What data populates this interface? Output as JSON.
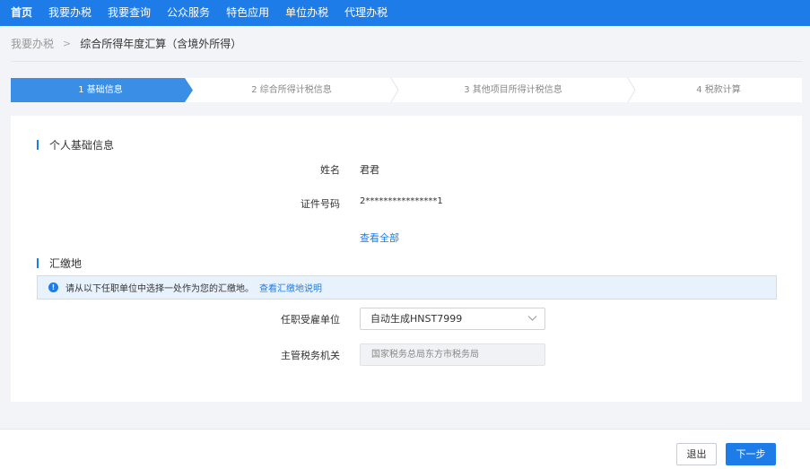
{
  "nav": {
    "items": [
      "首页",
      "我要办税",
      "我要查询",
      "公众服务",
      "特色应用",
      "单位办税",
      "代理办税"
    ],
    "active": 0
  },
  "breadcrumb": {
    "parent": "我要办税",
    "separator": ">",
    "current": "综合所得年度汇算（含境外所得）"
  },
  "steps": [
    "1 基础信息",
    "2 综合所得计税信息",
    "3 其他项目所得计税信息",
    "4 税款计算"
  ],
  "basic_info": {
    "title": "个人基础信息",
    "name_label": "姓名",
    "name_value": "君君",
    "id_label": "证件号码",
    "id_value": "2****************1",
    "view_all": "查看全部"
  },
  "filing_place": {
    "title": "汇缴地",
    "notice_text": "请从以下任职单位中选择一处作为您的汇缴地。",
    "notice_link": "查看汇缴地说明",
    "employer_label": "任职受雇单位",
    "employer_value": "自动生成HNST7999",
    "tax_office_label": "主管税务机关",
    "tax_office_value": "国家税务总局东方市税务局"
  },
  "footer": {
    "exit_label": "退出",
    "next_label": "下一步"
  },
  "colors": {
    "primary": "#1e7ce8",
    "notice_bg": "#e8f2fc",
    "page_bg": "#f2f4f7"
  }
}
